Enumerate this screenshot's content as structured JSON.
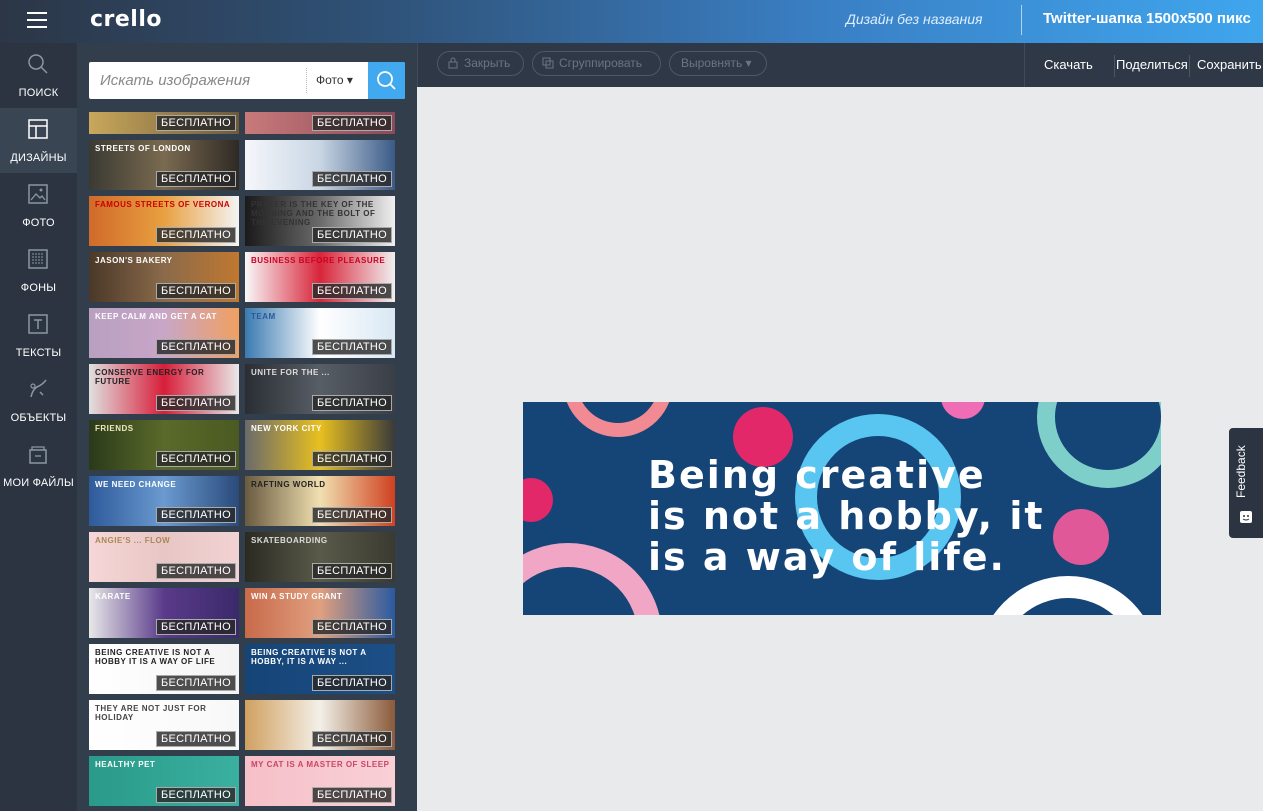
{
  "topbar": {
    "logo": "crello",
    "doc_title": "Дизайн без названия",
    "format": "Twitter-шапка 1500x500 пикс"
  },
  "nav": [
    {
      "label": "ПОИСК",
      "icon": "search-icon"
    },
    {
      "label": "ДИЗАЙНЫ",
      "icon": "layout-icon"
    },
    {
      "label": "ФОТО",
      "icon": "image-icon"
    },
    {
      "label": "ФОНЫ",
      "icon": "pattern-icon"
    },
    {
      "label": "ТЕКСТЫ",
      "icon": "text-icon"
    },
    {
      "label": "ОБЪЕКТЫ",
      "icon": "objects-icon"
    },
    {
      "label": "МОИ ФАЙЛЫ",
      "icon": "folder-icon"
    }
  ],
  "search": {
    "placeholder": "Искать изображения",
    "type": "Фото ▾"
  },
  "thumbs": {
    "badge": "БЕСПЛАТНО",
    "captions": [
      "",
      "",
      "Streets of London",
      "",
      "Famous streets of Verona",
      "Prayer is the key of the morning and the bolt of the evening",
      "Jason's Bakery",
      "Business before pleasure",
      "Keep calm and get a cat",
      "Team",
      "Conserve energy for future",
      "Unite for the ...",
      "Friends",
      "New York City",
      "We need change",
      "Rafting World",
      "Angie's ... Flow",
      "Skateboarding",
      "Karate",
      "Win a study grant",
      "Being creative is not a hobby it is a way of life",
      "Being creative is not a hobby, it is a way ...",
      "They are not just for holiday",
      "",
      "Healthy pet",
      "My Cat is a Master of Sleep"
    ]
  },
  "toolbar": {
    "lock": "Закрыть",
    "group": "Сгруппировать",
    "align": "Выровнять ▾",
    "download": "Скачать",
    "share": "Поделиться",
    "save": "Сохранить"
  },
  "design": {
    "headline": "Being creative\nis not a hobby, it\nis a way of life.",
    "bg_color": "#154477"
  },
  "feedback": "Feedback"
}
